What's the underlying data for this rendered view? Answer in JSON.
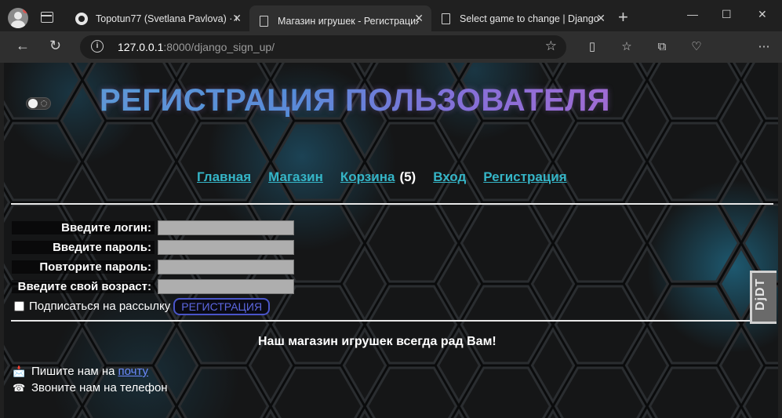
{
  "browser": {
    "tabs": [
      {
        "title": "Topotun77 (Svetlana Pavlova) · G",
        "icon": "github-icon",
        "active": false
      },
      {
        "title": "Магазин игрушек - Регистрация",
        "icon": "document-icon",
        "active": true
      },
      {
        "title": "Select game to change | Django",
        "icon": "document-icon",
        "active": false
      }
    ],
    "new_tab": "+",
    "window": {
      "minimize": "—",
      "maximize": "☐",
      "close": "✕"
    },
    "url_host": "127.0.0.1",
    "url_rest": ":8000/django_sign_up/"
  },
  "page": {
    "heading": "РЕГИСТРАЦИЯ ПОЛЬЗОВАТЕЛЯ",
    "menu": {
      "home": "Главная",
      "shop": "Магазин",
      "cart": "Корзина",
      "cart_count": "(5)",
      "login": "Вход",
      "register": "Регистрация"
    },
    "form": {
      "login_label": "Введите логин:",
      "password_label": "Введите пароль:",
      "repeat_label": "Повторите пароль:",
      "age_label": "Введите свой возраст:",
      "subscribe_label": "Подписаться на рассылку",
      "submit": "РЕГИСТРАЦИЯ"
    },
    "welcome": "Наш магазин игрушек всегда рад Вам!",
    "contacts": {
      "email_text": "Пишите нам на",
      "email_link": "почту",
      "phone_text": "Звоните нам на телефон"
    },
    "djdt": "DjDT"
  }
}
